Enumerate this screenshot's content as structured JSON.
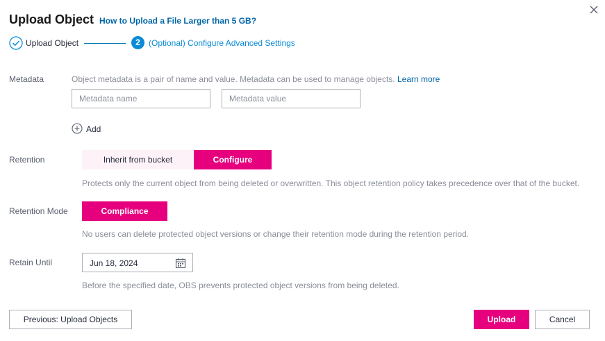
{
  "dialog": {
    "title": "Upload Object",
    "help_link": "How to Upload a File Larger than 5 GB?"
  },
  "steps": [
    {
      "label": "Upload Object",
      "state": "done"
    },
    {
      "number": "2",
      "label": "(Optional) Configure Advanced Settings",
      "state": "active"
    }
  ],
  "metadata": {
    "label": "Metadata",
    "description": "Object metadata is a pair of name and value. Metadata can be used to manage objects.",
    "learn_more": "Learn more",
    "name_placeholder": "Metadata name",
    "value_placeholder": "Metadata value",
    "add_label": "Add"
  },
  "retention": {
    "label": "Retention",
    "options": [
      "Inherit from bucket",
      "Configure"
    ],
    "selected": "Configure",
    "description": "Protects only the current object from being deleted or overwritten. This object retention policy takes precedence over that of the bucket."
  },
  "retention_mode": {
    "label": "Retention Mode",
    "value": "Compliance",
    "description": "No users can delete protected object versions or change their retention mode during the retention period."
  },
  "retain_until": {
    "label": "Retain Until",
    "value": "Jun 18, 2024",
    "description": "Before the specified date, OBS prevents protected object versions from being deleted."
  },
  "footer": {
    "previous_label": "Previous: Upload Objects",
    "upload_label": "Upload",
    "cancel_label": "Cancel"
  },
  "colors": {
    "accent": "#e6007e",
    "link": "#0066a6",
    "step_active": "#0a8bd6"
  },
  "icons": {
    "close": "close-icon",
    "step_done": "check-circle-icon",
    "add": "plus-circle-icon",
    "date": "calendar-icon"
  }
}
